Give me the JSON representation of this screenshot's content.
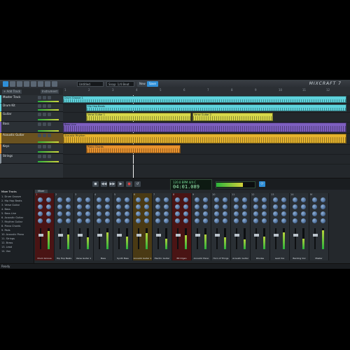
{
  "app": {
    "brand": "MIXCRAFT 7",
    "menu_dropdown": "Untitled",
    "view_dropdown": "Snap: 1/4 Beat",
    "new_button": "New",
    "save_button": "Save",
    "add_track_label": "+ Add Track",
    "add_instrument_label": "Instrument"
  },
  "colors": {
    "accent": "#2f8fd8",
    "cyan": "#5fd3dd",
    "yellow": "#d8d84a",
    "purple": "#7d5fbf",
    "gold": "#e5b32e",
    "orange": "#e8922e",
    "green_meter": "#2ab33b"
  },
  "ruler": {
    "ticks": [
      "1",
      "2",
      "3",
      "4",
      "5",
      "6",
      "7",
      "8",
      "9",
      "10",
      "11",
      "12"
    ]
  },
  "tracks": [
    {
      "name": "Master Track",
      "color": "#5fd3dd"
    },
    {
      "name": "Drum Kit",
      "color": "#5fd3dd"
    },
    {
      "name": "Guitar",
      "color": "#d8d84a"
    },
    {
      "name": "Bass",
      "color": "#7d5fbf"
    },
    {
      "name": "Acoustic Guitar",
      "color": "#e5b32e"
    },
    {
      "name": "Keys",
      "color": "#e8922e"
    },
    {
      "name": "Strings",
      "color": "#8a949d"
    }
  ],
  "clips": [
    {
      "label": "Drum Groove 1",
      "lane": 0
    },
    {
      "label": "Hip Hop Beats",
      "lane": 1
    },
    {
      "label": "Verse Guitar 1",
      "lane": 2
    },
    {
      "label": "Verse Guitar 2",
      "lane": 2
    },
    {
      "label": "Bass Line",
      "lane": 3
    },
    {
      "label": "Acoustic Rhythm",
      "lane": 4
    },
    {
      "label": "Piano Chords",
      "lane": 5
    }
  ],
  "transport": {
    "lcd_top": "120.0 BPM  4/4  C",
    "lcd_time": "04:01.089",
    "buttons": [
      "◼",
      "◀◀",
      "▶▶",
      "▶",
      "●",
      "↺"
    ]
  },
  "browser": {
    "title": "Mixer Tracks",
    "items": [
      "1. Drum Groove",
      "2. Hip Hop Beats",
      "3. Verse Guitar",
      "4. Bass",
      "5. Bass Line",
      "6. Acoustic Guitar",
      "7. Rhythm Guitar",
      "8. Piano Chords",
      "9. Pads",
      "10. Acoustic Piano",
      "11. Strings",
      "12. Brass",
      "13. Lead",
      "14. Vox"
    ]
  },
  "mixer": {
    "tab": "Mixer",
    "channels": [
      {
        "num": "1",
        "name": "Drum Groove",
        "color": "red",
        "level": 0.85
      },
      {
        "num": "2",
        "name": "Hip Hop Beats",
        "color": "",
        "level": 0.7
      },
      {
        "num": "3",
        "name": "Verse Guitar 1",
        "color": "",
        "level": 0.55
      },
      {
        "num": "4",
        "name": "Bass",
        "color": "",
        "level": 0.8
      },
      {
        "num": "5",
        "name": "Synth Bass",
        "color": "",
        "level": 0.6
      },
      {
        "num": "6",
        "name": "Acoustic Guitar 1",
        "color": "gold",
        "level": 0.75
      },
      {
        "num": "7",
        "name": "Electric Guitar",
        "color": "",
        "level": 0.5
      },
      {
        "num": "8",
        "name": "B3 Organ",
        "color": "red",
        "level": 0.65
      },
      {
        "num": "9",
        "name": "Acoustic Piano",
        "color": "",
        "level": 0.7
      },
      {
        "num": "10",
        "name": "Horn of Things",
        "color": "",
        "level": 0.55
      },
      {
        "num": "11",
        "name": "Acoustic Guitar",
        "color": "",
        "level": 0.45
      },
      {
        "num": "12",
        "name": "Rhodes",
        "color": "",
        "level": 0.6
      },
      {
        "num": "13",
        "name": "Lead Vox",
        "color": "",
        "level": 0.8
      },
      {
        "num": "14",
        "name": "Backing Vox",
        "color": "",
        "level": 0.5
      },
      {
        "num": "M",
        "name": "Master",
        "color": "",
        "level": 0.9
      }
    ]
  },
  "status": {
    "text": "Ready"
  }
}
